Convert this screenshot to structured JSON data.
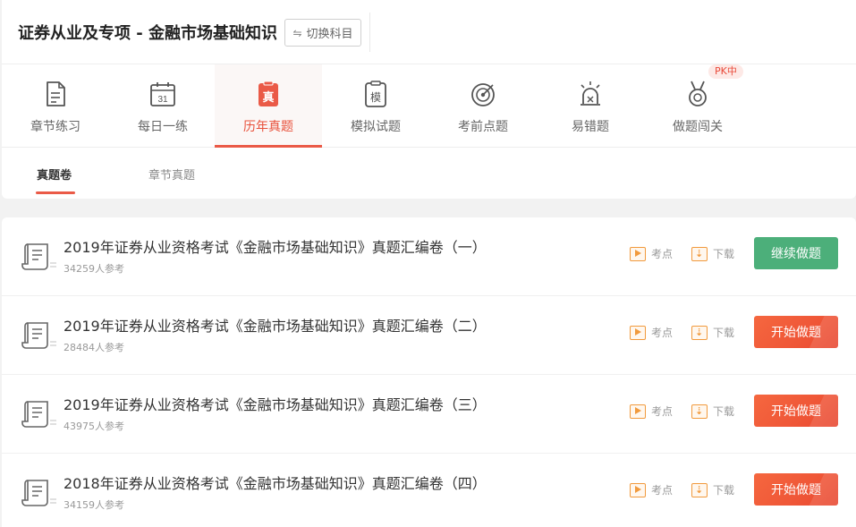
{
  "header": {
    "subject_title": "证券从业及专项 - 金融市场基础知识",
    "switch_label": "切换科目"
  },
  "nav": {
    "items": [
      {
        "label": "章节练习",
        "icon": "chapter-practice-icon"
      },
      {
        "label": "每日一练",
        "icon": "calendar-icon",
        "icon_text": "31"
      },
      {
        "label": "历年真题",
        "icon": "past-exam-icon",
        "icon_text": "真",
        "active": true
      },
      {
        "label": "模拟试题",
        "icon": "mock-exam-icon",
        "icon_text": "模"
      },
      {
        "label": "考前点题",
        "icon": "target-icon"
      },
      {
        "label": "易错题",
        "icon": "alarm-icon"
      },
      {
        "label": "做题闯关",
        "icon": "medal-icon"
      }
    ],
    "pk_badge": "PK中"
  },
  "subtabs": [
    {
      "label": "真题卷",
      "active": true
    },
    {
      "label": "章节真题"
    }
  ],
  "papers": [
    {
      "title": "2019年证券从业资格考试《金融市场基础知识》真题汇编卷（一）",
      "count": "34259人参考",
      "points_label": "考点",
      "download_label": "下载",
      "action_label": "继续做题",
      "action_style": "green"
    },
    {
      "title": "2019年证券从业资格考试《金融市场基础知识》真题汇编卷（二）",
      "count": "28484人参考",
      "points_label": "考点",
      "download_label": "下载",
      "action_label": "开始做题",
      "action_style": "orange"
    },
    {
      "title": "2019年证券从业资格考试《金融市场基础知识》真题汇编卷（三）",
      "count": "43975人参考",
      "points_label": "考点",
      "download_label": "下载",
      "action_label": "开始做题",
      "action_style": "orange"
    },
    {
      "title": "2018年证券从业资格考试《金融市场基础知识》真题汇编卷（四）",
      "count": "34159人参考",
      "points_label": "考点",
      "download_label": "下载",
      "action_label": "开始做题",
      "action_style": "orange"
    }
  ],
  "colors": {
    "accent": "#ea5a47",
    "green_button": "#4caf7a",
    "orange_icon": "#f19a3d"
  }
}
